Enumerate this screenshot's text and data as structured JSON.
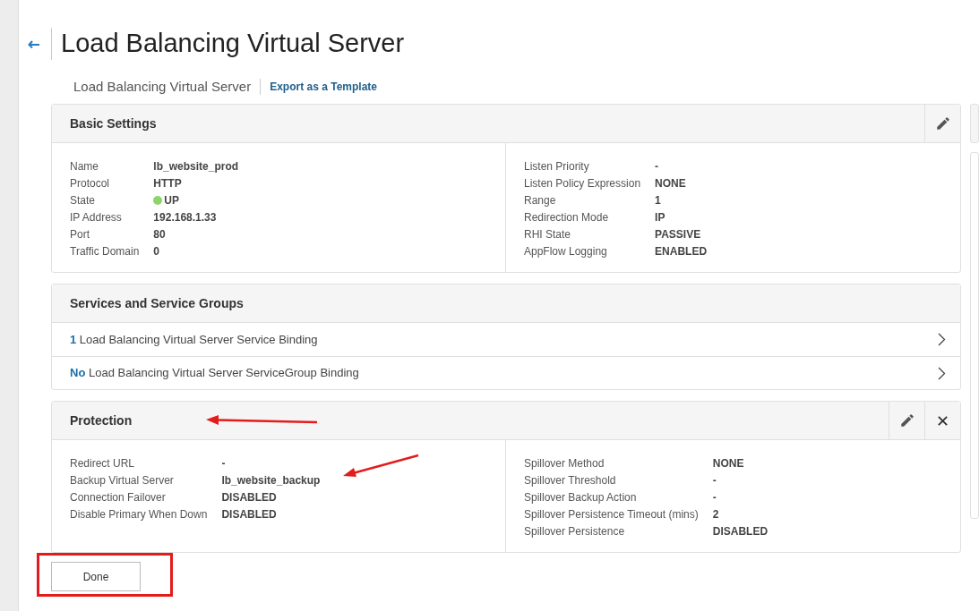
{
  "header": {
    "title": "Load Balancing Virtual Server",
    "breadcrumb": "Load Balancing Virtual Server",
    "export_link": "Export as a Template"
  },
  "sections": [
    {
      "kind": "details",
      "title": "Basic Settings",
      "removable": false,
      "left": [
        {
          "label": "Name",
          "value": "lb_website_prod"
        },
        {
          "label": "Protocol",
          "value": "HTTP"
        },
        {
          "label": "State",
          "value": "UP",
          "color": "#8fd46b"
        },
        {
          "label": "IP Address",
          "value": "192.168.1.33"
        },
        {
          "label": "Port",
          "value": "80"
        },
        {
          "label": "Traffic Domain",
          "value": "0"
        }
      ],
      "right": [
        {
          "label": "Listen Priority",
          "value": "-"
        },
        {
          "label": "Listen Policy Expression",
          "value": "NONE"
        },
        {
          "label": "Range",
          "value": "1"
        },
        {
          "label": "Redirection Mode",
          "value": "IP"
        },
        {
          "label": "RHI State",
          "value": "PASSIVE"
        },
        {
          "label": "AppFlow Logging",
          "value": "ENABLED"
        }
      ]
    },
    {
      "kind": "bindings",
      "title": "Services and Service Groups",
      "rows": [
        {
          "count": "1",
          "text": "Load Balancing Virtual Server Service Binding"
        },
        {
          "count": "No",
          "text": "Load Balancing Virtual Server ServiceGroup Binding"
        }
      ]
    },
    {
      "kind": "details",
      "title": "Protection",
      "removable": true,
      "left": [
        {
          "label": "Redirect URL",
          "value": "-"
        },
        {
          "label": "Backup Virtual Server",
          "value": "lb_website_backup"
        },
        {
          "label": "Connection Failover",
          "value": "DISABLED"
        },
        {
          "label": "Disable Primary When Down",
          "value": "DISABLED"
        }
      ],
      "right": [
        {
          "label": "Spillover Method",
          "value": "NONE"
        },
        {
          "label": "Spillover Threshold",
          "value": "-"
        },
        {
          "label": "Spillover Backup Action",
          "value": "-"
        },
        {
          "label": "Spillover Persistence Timeout (mins)",
          "value": "2"
        },
        {
          "label": "Spillover Persistence",
          "value": "DISABLED"
        }
      ]
    }
  ],
  "buttons": [
    "Done"
  ]
}
